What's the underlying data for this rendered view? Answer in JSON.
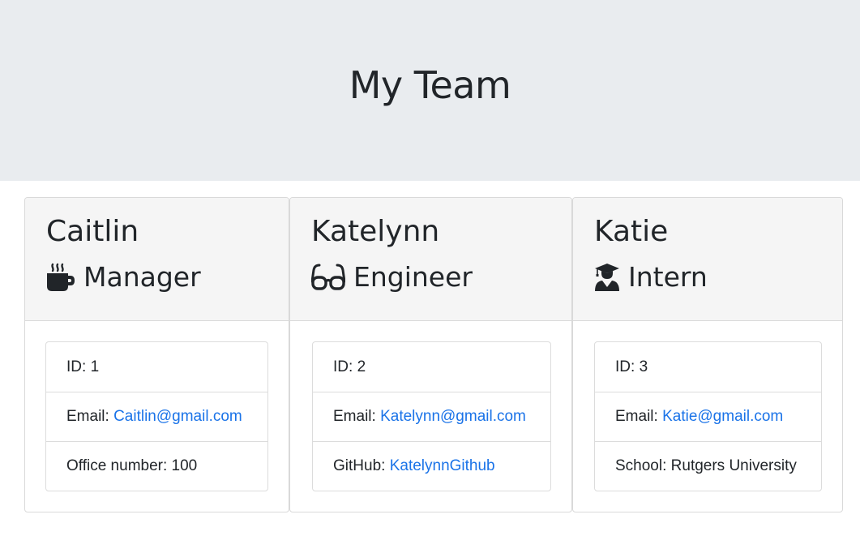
{
  "header": {
    "title": "My Team"
  },
  "team": [
    {
      "name": "Caitlin",
      "role": "Manager",
      "icon": "coffee-mug-icon",
      "id_label": "ID: ",
      "id": "1",
      "email_label": "Email: ",
      "email": "Caitlin@gmail.com",
      "extra_label": "Office number: ",
      "extra_value": "100"
    },
    {
      "name": "Katelynn",
      "role": "Engineer",
      "icon": "glasses-icon",
      "id_label": "ID: ",
      "id": "2",
      "email_label": "Email: ",
      "email": "Katelynn@gmail.com",
      "extra_label": "GitHub: ",
      "extra_value": "KatelynnGithub"
    },
    {
      "name": "Katie",
      "role": "Intern",
      "icon": "graduate-icon",
      "id_label": "ID: ",
      "id": "3",
      "email_label": "Email: ",
      "email": "Katie@gmail.com",
      "extra_label": "School: ",
      "extra_value": "Rutgers University"
    }
  ],
  "colors": {
    "jumbotron_bg": "#e9ecef",
    "card_header_bg": "#f5f5f5",
    "link": "#1a73e8",
    "text": "#212529"
  }
}
